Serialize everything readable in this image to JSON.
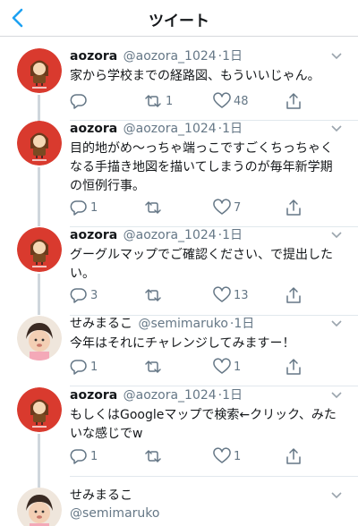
{
  "header": {
    "title": "ツイート"
  },
  "tweets": [
    {
      "name": "aozora",
      "handle": "@aozora_1024",
      "time": "1日",
      "text": "家から学校までの経路図、もういいじゃん。",
      "reply": "",
      "retweet": "1",
      "like": "48",
      "avatar": "aozora"
    },
    {
      "name": "aozora",
      "handle": "@aozora_1024",
      "time": "1日",
      "text": "目的地がめ〜っちゃ端っこですごくちっちゃくなる手描き地図を描いてしまうのが毎年新学期の恒例行事。",
      "reply": "1",
      "retweet": "",
      "like": "7",
      "avatar": "aozora"
    },
    {
      "name": "aozora",
      "handle": "@aozora_1024",
      "time": "1日",
      "text": "グーグルマップでご確認ください、で提出したい。",
      "reply": "3",
      "retweet": "",
      "like": "13",
      "avatar": "aozora"
    },
    {
      "name": "せみまるこ",
      "handle": "@semimaruko",
      "time": "1日",
      "text": "今年はそれにチャレンジしてみますー！",
      "reply": "1",
      "retweet": "",
      "like": "1",
      "avatar": "baby"
    },
    {
      "name": "aozora",
      "handle": "@aozora_1024",
      "time": "1日",
      "text": "もしくはGoogleマップで検索←クリック、みたいな感じでw",
      "reply": "1",
      "retweet": "",
      "like": "1",
      "avatar": "aozora"
    },
    {
      "name": "せみまるこ",
      "handle": "@semimaruko",
      "time": "",
      "text": "",
      "reply": "",
      "retweet": "",
      "like": "",
      "avatar": "baby"
    }
  ],
  "colors": {
    "accent": "#1da1f2",
    "avatar_red": "#d93a2e",
    "icon_gray": "#657786"
  },
  "icons": [
    "chevron-left-icon",
    "reply-icon",
    "retweet-icon",
    "heart-icon",
    "share-icon",
    "caret-down-icon"
  ]
}
